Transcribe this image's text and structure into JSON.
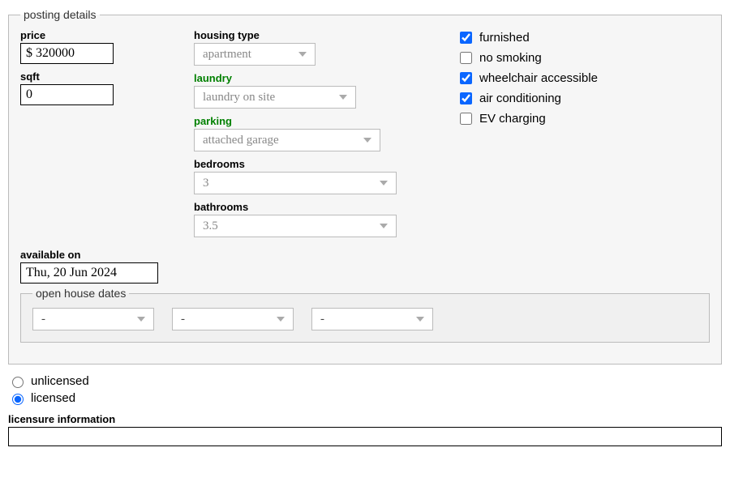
{
  "posting": {
    "legend": "posting details",
    "price": {
      "label": "price",
      "value": "$ 320000"
    },
    "sqft": {
      "label": "sqft",
      "value": "0"
    },
    "housing_type": {
      "label": "housing type",
      "value": "apartment"
    },
    "laundry": {
      "label": "laundry",
      "value": "laundry on site"
    },
    "parking": {
      "label": "parking",
      "value": "attached garage"
    },
    "bedrooms": {
      "label": "bedrooms",
      "value": "3"
    },
    "bathrooms": {
      "label": "bathrooms",
      "value": "3.5"
    },
    "amenities": {
      "furnished": {
        "label": "furnished",
        "checked": true
      },
      "no_smoking": {
        "label": "no smoking",
        "checked": false
      },
      "wheelchair": {
        "label": "wheelchair accessible",
        "checked": true
      },
      "ac": {
        "label": "air conditioning",
        "checked": true
      },
      "ev": {
        "label": "EV charging",
        "checked": false
      }
    },
    "available_on": {
      "label": "available on",
      "value": "Thu, 20 Jun 2024"
    },
    "open_house": {
      "legend": "open house dates",
      "slots": [
        "-",
        "-",
        "-"
      ]
    }
  },
  "licensure": {
    "unlicensed": {
      "label": "unlicensed",
      "checked": false
    },
    "licensed": {
      "label": "licensed",
      "checked": true
    },
    "info_label": "licensure information",
    "info_value": ""
  }
}
